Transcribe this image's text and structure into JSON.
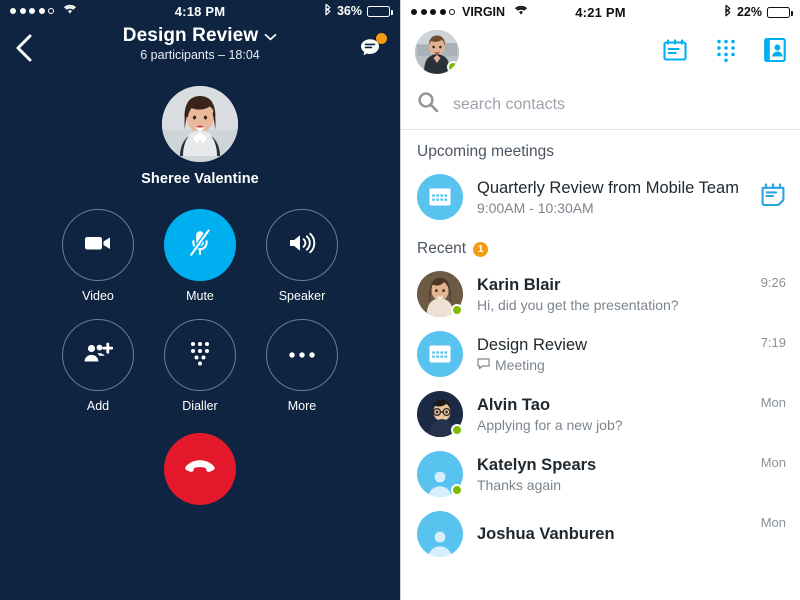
{
  "call": {
    "status_bar": {
      "signal_dots_filled": 4,
      "signal_dots_total": 5,
      "wifi_icon": "wifi-icon",
      "time": "4:18 PM",
      "bluetooth_icon": "bluetooth-icon",
      "battery_percent": "36%",
      "battery_level": 36
    },
    "back_icon": "back-chevron-icon",
    "title": "Design Review",
    "title_chevron_icon": "chevron-down-icon",
    "subtitle": "6 participants – 18:04",
    "chat_icon": "chat-bubble-icon",
    "chat_badge": true,
    "caller_name": "Sheree Valentine",
    "caller_avatar": "caller-avatar",
    "controls": [
      {
        "id": "video",
        "label": "Video",
        "icon": "video-camera-icon",
        "active": false
      },
      {
        "id": "mute",
        "label": "Mute",
        "icon": "microphone-muted-icon",
        "active": true
      },
      {
        "id": "speaker",
        "label": "Speaker",
        "icon": "speaker-icon",
        "active": false
      },
      {
        "id": "add",
        "label": "Add",
        "icon": "add-person-icon",
        "active": false
      },
      {
        "id": "dialler",
        "label": "Dialler",
        "icon": "dialpad-icon",
        "active": false
      },
      {
        "id": "more",
        "label": "More",
        "icon": "ellipsis-icon",
        "active": false
      }
    ],
    "end_call_icon": "end-call-handset-icon",
    "colors": {
      "background": "#0e2440",
      "accent": "#00aff0",
      "end_call": "#e3192b",
      "badge": "#f59b12"
    }
  },
  "contacts": {
    "status_bar": {
      "signal_dots_filled": 4,
      "signal_dots_total": 5,
      "carrier": "VIRGIN",
      "wifi_icon": "wifi-icon",
      "time": "4:21 PM",
      "bluetooth_icon": "bluetooth-icon",
      "battery_percent": "22%",
      "battery_level": 22
    },
    "header": {
      "avatar": "my-avatar",
      "presence": "online",
      "icons": [
        {
          "name": "meetings-calendar-icon"
        },
        {
          "name": "dialpad-icon"
        },
        {
          "name": "contacts-card-icon"
        }
      ]
    },
    "search": {
      "icon": "search-icon",
      "placeholder": "search contacts",
      "value": ""
    },
    "upcoming": {
      "title": "Upcoming meetings",
      "items": [
        {
          "avatar_icon": "calendar-avatar-icon",
          "title": "Quarterly Review from Mobile Team",
          "time": "9:00AM - 10:30AM",
          "action_icon": "join-meeting-calendar-icon"
        }
      ]
    },
    "recent": {
      "title": "Recent",
      "badge": "1",
      "items": [
        {
          "avatar_type": "photo",
          "avatar": "karin-avatar",
          "presence": "online",
          "name": "Karin Blair",
          "name_bold": true,
          "preview": "Hi, did you get the presentation?",
          "preview_icon": "",
          "time": "9:26"
        },
        {
          "avatar_type": "group",
          "avatar": "calendar-avatar-icon",
          "presence": "",
          "name": "Design Review",
          "name_bold": false,
          "preview": "Meeting",
          "preview_icon": "chat-bubble-small-icon",
          "time": "7:19"
        },
        {
          "avatar_type": "photo",
          "avatar": "alvin-avatar",
          "presence": "online",
          "name": "Alvin Tao",
          "name_bold": true,
          "preview": "Applying for a new job?",
          "preview_icon": "",
          "time": "Mon"
        },
        {
          "avatar_type": "person",
          "avatar": "default-person-avatar",
          "presence": "online",
          "name": "Katelyn Spears",
          "name_bold": true,
          "preview": "Thanks again",
          "preview_icon": "",
          "time": "Mon"
        },
        {
          "avatar_type": "person",
          "avatar": "default-person-avatar",
          "presence": "",
          "name": "Joshua Vanburen",
          "name_bold": true,
          "preview": "",
          "preview_icon": "",
          "time": "Mon"
        }
      ]
    },
    "colors": {
      "accent": "#00aff0",
      "avatar_blue": "#58c3ef",
      "presence_green": "#7fba00",
      "badge": "#f59b12"
    }
  }
}
